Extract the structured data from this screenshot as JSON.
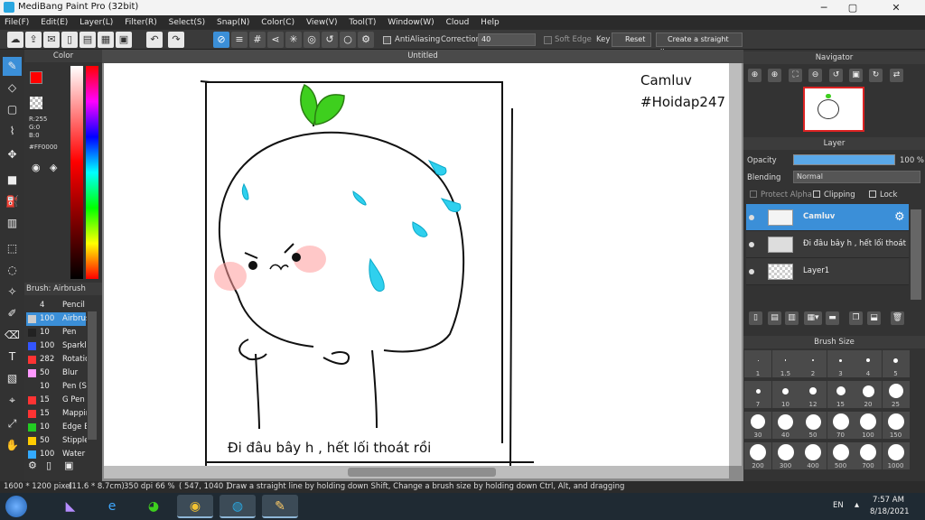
{
  "window": {
    "title": "MediBang Paint Pro (32bit)",
    "min": "─",
    "max": "▢",
    "close": "✕"
  },
  "menu": [
    "File(F)",
    "Edit(E)",
    "Layer(L)",
    "Filter(R)",
    "Select(S)",
    "Snap(N)",
    "Color(C)",
    "View(V)",
    "Tool(T)",
    "Window(W)",
    "Cloud",
    "Help"
  ],
  "toolbar": {
    "antialiasing": "AntiAliasing",
    "correction_label": "Correction",
    "correction_value": "40",
    "soft_edge": "Soft Edge",
    "key": "Key",
    "reset": "Reset",
    "straight_line": "Create a straight line"
  },
  "color_panel": {
    "title": "Color",
    "r": "R:255",
    "g": "G:0",
    "b": "B:0",
    "hex": "#FF0000",
    "fg": "#ff0000",
    "bg": "#000000"
  },
  "brush_panel": {
    "title": "Brush: Airbrush",
    "items": [
      {
        "size": "4",
        "name": "Pencil",
        "color": "#333333"
      },
      {
        "size": "100",
        "name": "Airbrush",
        "color": "#cccccc"
      },
      {
        "size": "10",
        "name": "Pen",
        "color": "#222222"
      },
      {
        "size": "100",
        "name": "Sparkle",
        "color": "#3355ff"
      },
      {
        "size": "282",
        "name": "Rotation",
        "color": "#ff3333"
      },
      {
        "size": "50",
        "name": "Blur",
        "color": "#ff99ff"
      },
      {
        "size": "10",
        "name": "Pen (S",
        "color": "#333333"
      },
      {
        "size": "15",
        "name": "G Pen",
        "color": "#ff3333"
      },
      {
        "size": "15",
        "name": "Mapping",
        "color": "#ff3333"
      },
      {
        "size": "10",
        "name": "Edge B",
        "color": "#22cc22"
      },
      {
        "size": "50",
        "name": "Stipple",
        "color": "#ffcc00"
      },
      {
        "size": "100",
        "name": "Water",
        "color": "#33aaff"
      }
    ]
  },
  "document": {
    "tab": "Untitled",
    "watermark_line1": "Camluv",
    "watermark_line2": "#Hoidap247",
    "caption": "Đi đâu bây h , hết lối thoát rồi"
  },
  "navigator": {
    "title": "Navigator"
  },
  "layer_panel": {
    "title": "Layer",
    "opacity_label": "Opacity",
    "opacity_value": "100 %",
    "blending_label": "Blending",
    "blending_value": "Normal",
    "protect_alpha": "Protect Alpha",
    "clipping": "Clipping",
    "lock": "Lock",
    "layers": [
      {
        "name": "Camluv"
      },
      {
        "name": "Đi đâu bây h , hết lối thoát"
      },
      {
        "name": "Layer1"
      }
    ]
  },
  "brush_size": {
    "title": "Brush Size",
    "sizes": [
      "1",
      "1.5",
      "2",
      "3",
      "4",
      "5",
      "7",
      "10",
      "12",
      "15",
      "20",
      "25",
      "30",
      "40",
      "50",
      "70",
      "100",
      "150",
      "200",
      "300",
      "400",
      "500",
      "700",
      "1000"
    ]
  },
  "status": {
    "dimensions": "1600 * 1200 pixel",
    "physical": "(11.6 * 8.7cm)",
    "dpi": "350 dpi",
    "zoom": "66 %",
    "coords": "( 547, 1040 )",
    "hint": "Draw a straight line by holding down Shift, Change a brush size by holding down Ctrl, Alt, and dragging"
  },
  "taskbar": {
    "lang": "EN",
    "time": "7:57 AM",
    "date": "8/18/2021"
  },
  "colors": {
    "accent": "#3b8fd8",
    "sprout": "#3ecf1e",
    "drop": "#2fd0ee",
    "blush": "#ff9a9a"
  }
}
